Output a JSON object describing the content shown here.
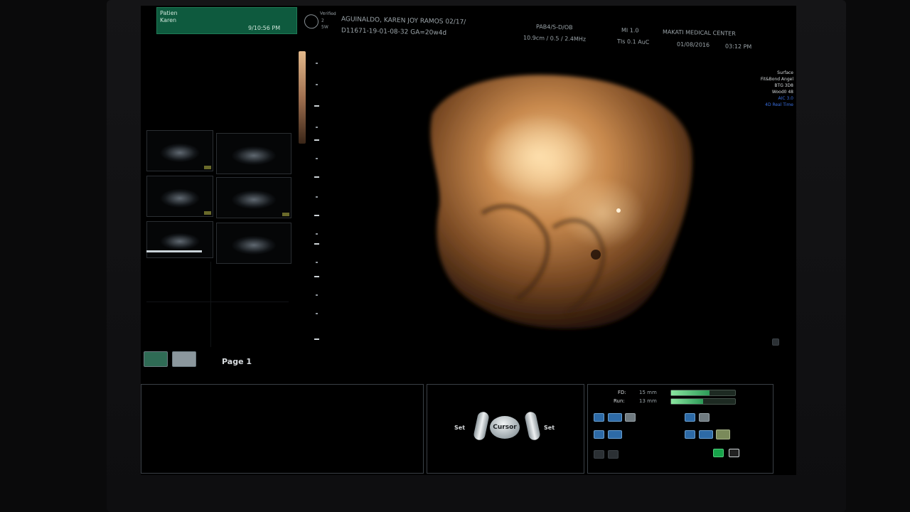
{
  "patient": {
    "line1": "Patien",
    "line2": "Karen",
    "time": "9/10:56 PM"
  },
  "header": {
    "row1_left": "AGUINALDO, KAREN JOY RAMOS 02/17/",
    "row1_mid": "PAB4/S-D/OB",
    "row1_right1": "MI 1.0",
    "row1_right2": "MAKATI MEDICAL CENTER",
    "row2_left": "D11671-19-01-08-32  GA=20w4d",
    "row2_mid": "10.9cm / 0.5 / 2.4MHz",
    "row2_right1": "TIs 0.1  AuC",
    "row2_right2": "01/08/2016",
    "row2_right3": "03:12 PM",
    "logo_side_top": "Verified",
    "logo_side_mid": "2",
    "logo_side_bot": "5W"
  },
  "info_panel": {
    "items": [
      "Surface",
      "Fit&Bond Angel",
      "BTG 3D8",
      "Wood0 48",
      "AIC 3.0"
    ],
    "mode": "4D Real Time"
  },
  "pagination": {
    "label": "Page 1"
  },
  "controls": {
    "trackball_label": "Cursor",
    "set_left": "Set",
    "set_right": "Set",
    "fd_label": "FD:",
    "fd_value": "15 mm",
    "fd_level": 0.6,
    "run_label": "Run:",
    "run_value": "13 mm",
    "run_level": 0.5
  },
  "colors": {
    "accent_green": "#0e5a3e",
    "render_sepia": "#c98a4e",
    "mode_blue": "#3a6fe0"
  },
  "icons": [
    "logo-icon",
    "trackball-icon",
    "print-icon",
    "phone-icon",
    "settings-icon"
  ]
}
